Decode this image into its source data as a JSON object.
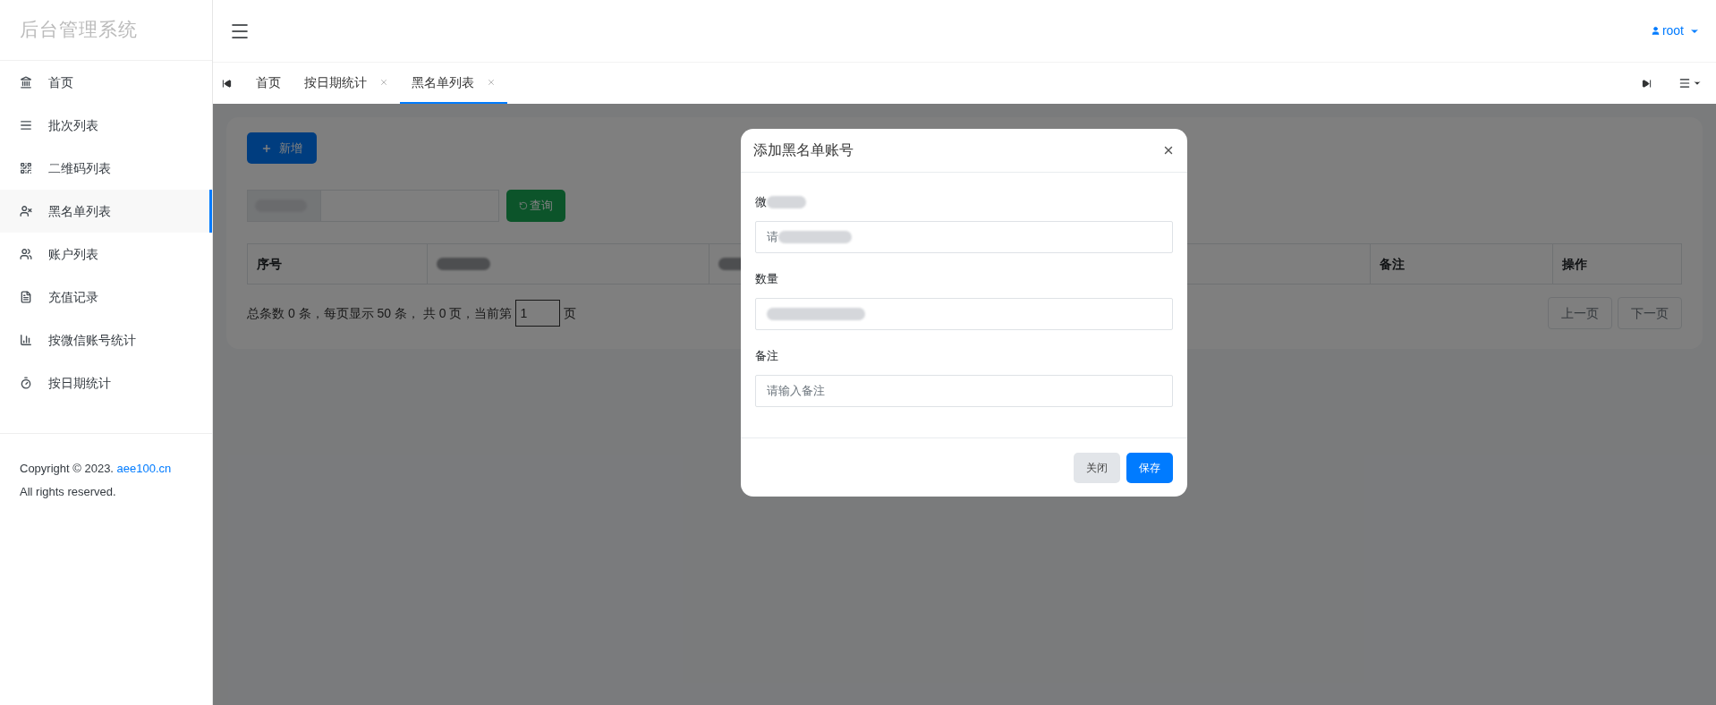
{
  "sidebar": {
    "title": "后台管理系统",
    "items": [
      {
        "label": "首页",
        "selected": false
      },
      {
        "label": "批次列表",
        "selected": false
      },
      {
        "label": "二维码列表",
        "selected": false
      },
      {
        "label": "黑名单列表",
        "selected": true
      },
      {
        "label": "账户列表",
        "selected": false
      },
      {
        "label": "充值记录",
        "selected": false
      },
      {
        "label": "按微信账号统计",
        "selected": false
      },
      {
        "label": "按日期统计",
        "selected": false
      }
    ],
    "footer": {
      "copyright": "Copyright © 2023.",
      "link": "aee100.cn",
      "rights": "All rights reserved."
    }
  },
  "header": {
    "user": "root"
  },
  "tabs": [
    {
      "label": "首页",
      "closable": false,
      "selected": false
    },
    {
      "label": "按日期统计",
      "closable": true,
      "selected": false
    },
    {
      "label": "黑名单列表",
      "closable": true,
      "selected": true
    }
  ],
  "page": {
    "add_button": "新增",
    "search_button": "查询",
    "table": {
      "columns": [
        {
          "kind": "text",
          "label": "序号"
        },
        {
          "kind": "redacted"
        },
        {
          "kind": "redacted"
        },
        {
          "kind": "text",
          "label": "备注"
        },
        {
          "kind": "text",
          "label": "操作"
        }
      ]
    },
    "pagination": {
      "summary": "总条数 0 条，每页显示 50 条， 共 0 页，当前第",
      "page": "1",
      "suffix": "页",
      "prev": "上一页",
      "next": "下一页"
    }
  },
  "modal": {
    "title": "添加黑名单账号",
    "fields": [
      {
        "label": "微",
        "label_redacted": true,
        "placeholder": "请",
        "placeholder_redacted": true
      },
      {
        "label": "数量",
        "value_redacted": true
      },
      {
        "label": "备注",
        "placeholder": "请输入备注"
      }
    ],
    "close_button": "关闭",
    "save_button": "保存"
  }
}
